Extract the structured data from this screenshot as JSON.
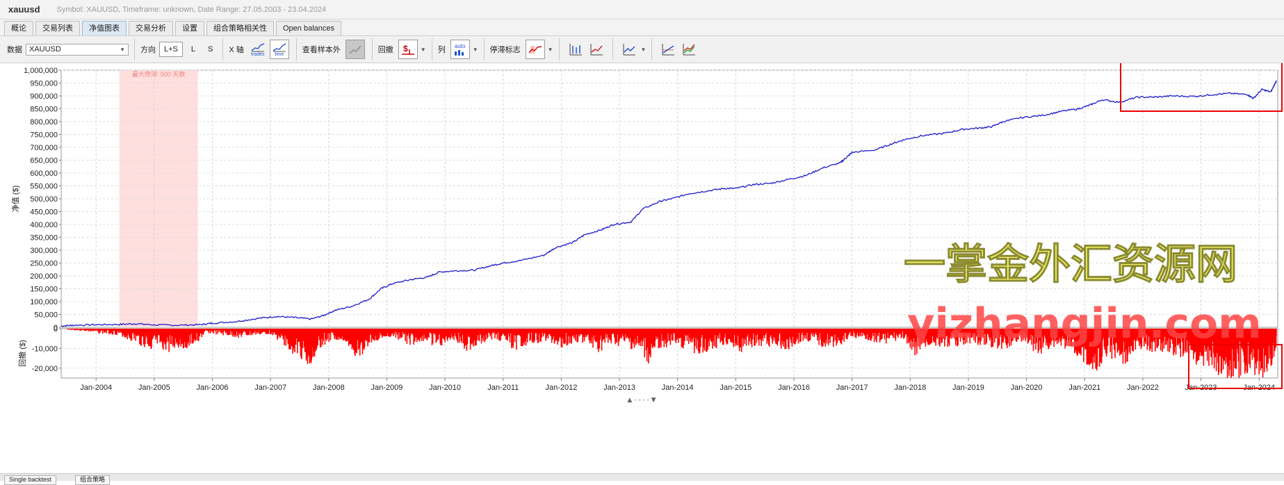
{
  "app": {
    "title": "xauusd",
    "info": "Symbol: XAUUSD, Timeframe: unknown, Date Range: 27.05.2003 - 23.04.2024"
  },
  "tabs": [
    {
      "label": "概论"
    },
    {
      "label": "交易列表"
    },
    {
      "label": "净值图表",
      "active": true
    },
    {
      "label": "交易分析"
    },
    {
      "label": "设置"
    },
    {
      "label": "组合策略相关性"
    },
    {
      "label": "Open balances"
    }
  ],
  "toolbar": {
    "data_label": "数据",
    "data_value": "XAUUSD",
    "direction_label": "方向",
    "dir_options": [
      "L+S",
      "L",
      "S"
    ],
    "x_axis_label": "X 轴",
    "x_trades": "trades",
    "x_time": "time",
    "oos_label": "查看样本外",
    "drawdown_label": "回撤",
    "columns_label": "列",
    "columns_auto": "auto",
    "stagnation_label": "停滞标志"
  },
  "bottom_tabs": [
    "Single backtest",
    "组合策略"
  ],
  "colors": {
    "equity": "#1a1acc",
    "drawdown": "#ff0000",
    "stagnation": "#ffdede",
    "highlight": "#ee0000"
  },
  "chart_data": {
    "type": "line",
    "equity": {
      "ylabel": "净值 ($)",
      "ylim": [
        0,
        1000000
      ],
      "yticks": [
        0,
        50000,
        100000,
        150000,
        200000,
        250000,
        300000,
        350000,
        400000,
        450000,
        500000,
        550000,
        600000,
        650000,
        700000,
        750000,
        800000,
        850000,
        900000,
        950000,
        1000000
      ],
      "ytick_labels": [
        "0",
        "50,000",
        "100,000",
        "150,000",
        "200,000",
        "250,000",
        "300,000",
        "350,000",
        "400,000",
        "450,000",
        "500,000",
        "550,000",
        "600,000",
        "650,000",
        "700,000",
        "750,000",
        "800,000",
        "850,000",
        "900,000",
        "950,000",
        "1,000,000"
      ],
      "points": [
        [
          2003.4,
          5000
        ],
        [
          2003.6,
          8000
        ],
        [
          2004.0,
          10000
        ],
        [
          2004.4,
          11000
        ],
        [
          2004.7,
          14000
        ],
        [
          2005.0,
          9000
        ],
        [
          2005.4,
          8000
        ],
        [
          2005.8,
          10000
        ],
        [
          2006.0,
          16000
        ],
        [
          2006.4,
          22000
        ],
        [
          2006.8,
          35000
        ],
        [
          2007.1,
          42000
        ],
        [
          2007.4,
          38000
        ],
        [
          2007.7,
          32000
        ],
        [
          2007.9,
          45000
        ],
        [
          2008.1,
          65000
        ],
        [
          2008.4,
          82000
        ],
        [
          2008.7,
          110000
        ],
        [
          2008.9,
          150000
        ],
        [
          2009.1,
          170000
        ],
        [
          2009.4,
          185000
        ],
        [
          2009.7,
          195000
        ],
        [
          2009.9,
          215000
        ],
        [
          2010.2,
          220000
        ],
        [
          2010.5,
          222000
        ],
        [
          2010.8,
          240000
        ],
        [
          2011.0,
          250000
        ],
        [
          2011.3,
          260000
        ],
        [
          2011.7,
          280000
        ],
        [
          2011.9,
          310000
        ],
        [
          2012.2,
          330000
        ],
        [
          2012.4,
          360000
        ],
        [
          2012.7,
          380000
        ],
        [
          2012.9,
          400000
        ],
        [
          2013.2,
          410000
        ],
        [
          2013.4,
          460000
        ],
        [
          2013.7,
          490000
        ],
        [
          2013.9,
          500000
        ],
        [
          2014.2,
          520000
        ],
        [
          2014.5,
          530000
        ],
        [
          2014.8,
          540000
        ],
        [
          2015.0,
          540000
        ],
        [
          2015.3,
          555000
        ],
        [
          2015.6,
          560000
        ],
        [
          2015.9,
          575000
        ],
        [
          2016.2,
          590000
        ],
        [
          2016.5,
          620000
        ],
        [
          2016.8,
          640000
        ],
        [
          2016.9,
          660000
        ],
        [
          2017.0,
          680000
        ],
        [
          2017.4,
          690000
        ],
        [
          2017.7,
          715000
        ],
        [
          2017.9,
          730000
        ],
        [
          2018.2,
          745000
        ],
        [
          2018.6,
          755000
        ],
        [
          2018.9,
          770000
        ],
        [
          2019.2,
          775000
        ],
        [
          2019.4,
          780000
        ],
        [
          2019.6,
          800000
        ],
        [
          2019.9,
          815000
        ],
        [
          2020.3,
          825000
        ],
        [
          2020.6,
          840000
        ],
        [
          2020.9,
          850000
        ],
        [
          2021.1,
          865000
        ],
        [
          2021.3,
          885000
        ],
        [
          2021.6,
          875000
        ],
        [
          2021.9,
          895000
        ],
        [
          2022.2,
          895000
        ],
        [
          2022.5,
          900000
        ],
        [
          2022.9,
          898000
        ],
        [
          2023.2,
          905000
        ],
        [
          2023.5,
          910000
        ],
        [
          2023.8,
          905000
        ],
        [
          2023.9,
          890000
        ],
        [
          2024.05,
          925000
        ],
        [
          2024.2,
          915000
        ],
        [
          2024.3,
          960000
        ]
      ]
    },
    "drawdown": {
      "ylabel": "回撤 ($)",
      "ylim": [
        -25000,
        0
      ],
      "yticks": [
        0,
        -10000,
        -20000
      ],
      "ytick_labels": [
        "0",
        "-10,000",
        "-20,000"
      ],
      "points": [
        [
          2003.5,
          -500
        ],
        [
          2003.8,
          -1200
        ],
        [
          2004.1,
          -2500
        ],
        [
          2004.4,
          -3000
        ],
        [
          2004.6,
          -6000
        ],
        [
          2004.9,
          -10000
        ],
        [
          2005.0,
          -9000
        ],
        [
          2005.2,
          -11000
        ],
        [
          2005.5,
          -9500
        ],
        [
          2005.7,
          -8000
        ],
        [
          2005.9,
          -2000
        ],
        [
          2006.2,
          -3500
        ],
        [
          2006.5,
          -4500
        ],
        [
          2006.8,
          -3000
        ],
        [
          2007.0,
          -2500
        ],
        [
          2007.2,
          -7000
        ],
        [
          2007.4,
          -12000
        ],
        [
          2007.6,
          -16000
        ],
        [
          2007.7,
          -18000
        ],
        [
          2007.8,
          -10000
        ],
        [
          2008.1,
          -5000
        ],
        [
          2008.3,
          -6000
        ],
        [
          2008.5,
          -16000
        ],
        [
          2008.7,
          -7000
        ],
        [
          2008.9,
          -5000
        ],
        [
          2009.1,
          -4000
        ],
        [
          2009.4,
          -8000
        ],
        [
          2009.6,
          -6000
        ],
        [
          2009.9,
          -9000
        ],
        [
          2010.1,
          -5000
        ],
        [
          2010.4,
          -11000
        ],
        [
          2010.6,
          -7000
        ],
        [
          2010.9,
          -5000
        ],
        [
          2011.2,
          -10000
        ],
        [
          2011.5,
          -7000
        ],
        [
          2011.8,
          -6000
        ],
        [
          2012.0,
          -9000
        ],
        [
          2012.3,
          -6000
        ],
        [
          2012.6,
          -12000
        ],
        [
          2012.9,
          -8000
        ],
        [
          2013.2,
          -10000
        ],
        [
          2013.5,
          -17000
        ],
        [
          2013.7,
          -9000
        ],
        [
          2014.0,
          -8000
        ],
        [
          2014.3,
          -12000
        ],
        [
          2014.6,
          -10000
        ],
        [
          2014.9,
          -8000
        ],
        [
          2015.1,
          -11000
        ],
        [
          2015.4,
          -8000
        ],
        [
          2015.7,
          -9000
        ],
        [
          2015.9,
          -10000
        ],
        [
          2016.2,
          -6000
        ],
        [
          2016.5,
          -9000
        ],
        [
          2016.8,
          -8000
        ],
        [
          2017.0,
          -4000
        ],
        [
          2017.3,
          -6000
        ],
        [
          2017.6,
          -7000
        ],
        [
          2017.9,
          -5000
        ],
        [
          2018.1,
          -13000
        ],
        [
          2018.4,
          -8000
        ],
        [
          2018.7,
          -9000
        ],
        [
          2019.0,
          -7000
        ],
        [
          2019.3,
          -8000
        ],
        [
          2019.6,
          -10000
        ],
        [
          2019.9,
          -6000
        ],
        [
          2020.2,
          -12000
        ],
        [
          2020.5,
          -9000
        ],
        [
          2020.8,
          -11000
        ],
        [
          2021.0,
          -16000
        ],
        [
          2021.2,
          -20000
        ],
        [
          2021.4,
          -13000
        ],
        [
          2021.7,
          -17000
        ],
        [
          2021.9,
          -10000
        ],
        [
          2022.2,
          -11000
        ],
        [
          2022.5,
          -12000
        ],
        [
          2022.8,
          -15000
        ],
        [
          2023.0,
          -18000
        ],
        [
          2023.2,
          -20000
        ],
        [
          2023.4,
          -23000
        ],
        [
          2023.6,
          -25000
        ],
        [
          2023.8,
          -22000
        ],
        [
          2024.0,
          -24000
        ],
        [
          2024.2,
          -20000
        ],
        [
          2024.3,
          -8000
        ]
      ]
    },
    "x_ticks": [
      {
        "v": 2004.0,
        "label": "Jan-2004"
      },
      {
        "v": 2005.0,
        "label": "Jan-2005"
      },
      {
        "v": 2006.0,
        "label": "Jan-2006"
      },
      {
        "v": 2007.0,
        "label": "Jan-2007"
      },
      {
        "v": 2008.0,
        "label": "Jan-2008"
      },
      {
        "v": 2009.0,
        "label": "Jan-2009"
      },
      {
        "v": 2010.0,
        "label": "Jan-2010"
      },
      {
        "v": 2011.0,
        "label": "Jan-2011"
      },
      {
        "v": 2012.0,
        "label": "Jan-2012"
      },
      {
        "v": 2013.0,
        "label": "Jan-2013"
      },
      {
        "v": 2014.0,
        "label": "Jan-2014"
      },
      {
        "v": 2015.0,
        "label": "Jan-2015"
      },
      {
        "v": 2016.0,
        "label": "Jan-2016"
      },
      {
        "v": 2017.0,
        "label": "Jan-2017"
      },
      {
        "v": 2018.0,
        "label": "Jan-2018"
      },
      {
        "v": 2019.0,
        "label": "Jan-2019"
      },
      {
        "v": 2020.0,
        "label": "Jan-2020"
      },
      {
        "v": 2021.0,
        "label": "Jan-2021"
      },
      {
        "v": 2022.0,
        "label": "Jan-2022"
      },
      {
        "v": 2023.0,
        "label": "Jan-2023"
      },
      {
        "v": 2024.0,
        "label": "Jan-2024"
      }
    ],
    "xlim": [
      2003.4,
      2024.32
    ],
    "stagnation": {
      "start": 2004.4,
      "end": 2005.75,
      "label": "最大停滞: 500 天数"
    },
    "grid": true
  },
  "watermark": {
    "line1": "一掌金外汇资源网",
    "line2": "yizhangjin.com"
  }
}
